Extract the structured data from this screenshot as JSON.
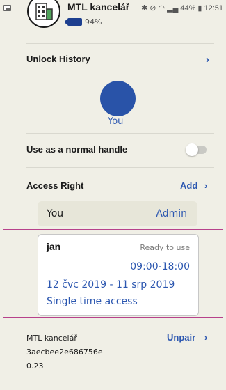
{
  "status_bar": {
    "icons": [
      "bluetooth-icon",
      "mute-icon",
      "wifi-icon",
      "signal-icon",
      "battery-icon"
    ],
    "battery": "44%",
    "time": "12:51"
  },
  "header": {
    "door_name": "MTL kancelář",
    "battery_percent": "94%"
  },
  "unlock_history": {
    "label": "Unlock History",
    "user_label": "You"
  },
  "normal_handle": {
    "label": "Use as a normal handle"
  },
  "access_right": {
    "label": "Access Right",
    "add_label": "Add",
    "entries": [
      {
        "name": "You",
        "role": "Admin"
      },
      {
        "name": "jan",
        "status": "Ready to use",
        "time": "09:00-18:00",
        "dates": "12 čvc 2019 - 11 srp 2019",
        "type": "Single time access"
      }
    ]
  },
  "footer": {
    "name": "MTL kancelář",
    "id": "3aecbee2e686756e",
    "version": "0.23",
    "unpair_label": "Unpair"
  },
  "colors": {
    "accent": "#2c57b0",
    "background": "#f0efe6",
    "highlight": "#b7418b"
  }
}
